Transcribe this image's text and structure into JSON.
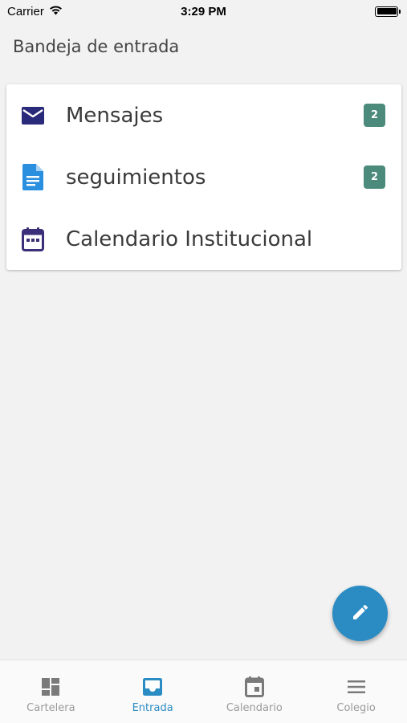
{
  "status_bar": {
    "carrier": "Carrier",
    "time": "3:29 PM"
  },
  "page": {
    "title": "Bandeja de entrada"
  },
  "menu": {
    "items": [
      {
        "label": "Mensajes",
        "icon": "mail-icon",
        "badge": "2"
      },
      {
        "label": "seguimientos",
        "icon": "document-icon",
        "badge": "2"
      },
      {
        "label": "Calendario Institucional",
        "icon": "calendar-icon",
        "badge": null
      }
    ]
  },
  "fab": {
    "icon": "pencil-icon"
  },
  "tabs": [
    {
      "label": "Cartelera",
      "icon": "dashboard-icon",
      "active": false
    },
    {
      "label": "Entrada",
      "icon": "inbox-icon",
      "active": true
    },
    {
      "label": "Calendario",
      "icon": "calendar-icon",
      "active": false
    },
    {
      "label": "Colegio",
      "icon": "menu-icon",
      "active": false
    }
  ],
  "colors": {
    "accent": "#2b8cc4",
    "badge": "#4c8a7c",
    "mail_icon": "#2a2a7a",
    "document_icon": "#2b8fe0",
    "calendar_icon": "#3b2f7a",
    "tab_inactive": "#8a8a8a"
  }
}
